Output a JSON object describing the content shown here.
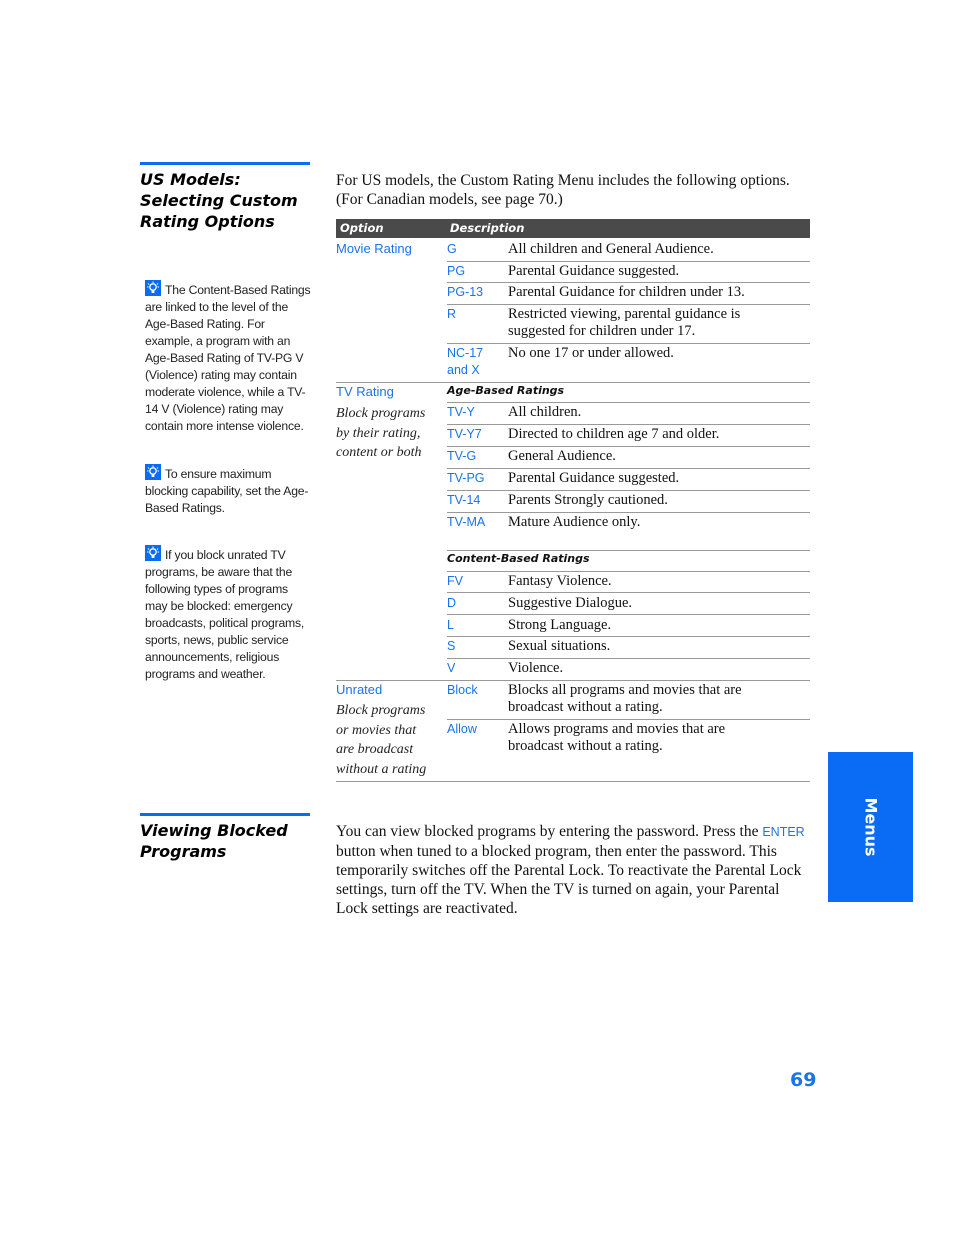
{
  "section1": {
    "heading_lines": [
      "US Models:",
      "Selecting Custom",
      "Rating Options"
    ],
    "intro": "For US models, the Custom Rating Menu includes the following options. (For Canadian models, see page 70.)"
  },
  "notes": [
    {
      "icon": "lightbulb-tip-icon",
      "text": "The Content-Based Ratings are linked to the level of the Age-Based Rating. For example, a program with an Age-Based Rating of TV-PG V (Violence) rating may contain moderate violence, while a TV-14 V (Violence) rating may contain more intense violence."
    },
    {
      "icon": "lightbulb-tip-icon",
      "text": "To ensure maximum blocking capability, set the Age-Based Ratings."
    },
    {
      "icon": "lightbulb-tip-icon",
      "text": "If you block unrated TV programs, be aware that the following types of programs may be blocked: emergency broadcasts, political programs, sports, news, public service announcements, religious programs and weather."
    }
  ],
  "table": {
    "headers": {
      "option": "Option",
      "description": "Description"
    },
    "movie": {
      "option": "Movie Rating",
      "rows": [
        {
          "code": "G",
          "desc": "All children and General Audience."
        },
        {
          "code": "PG",
          "desc": "Parental Guidance suggested."
        },
        {
          "code": "PG-13",
          "desc": "Parental Guidance for children under 13."
        },
        {
          "code": "R",
          "desc": "Restricted viewing, parental guidance is suggested for children under 17."
        },
        {
          "code": "NC-17 and X",
          "desc": "No one 17 or under allowed."
        }
      ]
    },
    "tv": {
      "option": "TV Rating",
      "option_note": "Block programs by their rating, content or both",
      "age_heading": "Age-Based Ratings",
      "age_rows": [
        {
          "code": "TV-Y",
          "desc": "All children."
        },
        {
          "code": "TV-Y7",
          "desc": "Directed to children age 7 and older."
        },
        {
          "code": "TV-G",
          "desc": "General Audience."
        },
        {
          "code": "TV-PG",
          "desc": "Parental Guidance suggested."
        },
        {
          "code": "TV-14",
          "desc": "Parents Strongly cautioned."
        },
        {
          "code": "TV-MA",
          "desc": "Mature Audience only."
        }
      ],
      "content_heading": "Content-Based Ratings",
      "content_rows": [
        {
          "code": "FV",
          "desc": "Fantasy Violence."
        },
        {
          "code": "D",
          "desc": "Suggestive Dialogue."
        },
        {
          "code": "L",
          "desc": "Strong Language."
        },
        {
          "code": "S",
          "desc": "Sexual situations."
        },
        {
          "code": "V",
          "desc": "Violence."
        }
      ]
    },
    "unrated": {
      "option": "Unrated",
      "option_note": "Block programs or movies that are broadcast without a rating",
      "rows": [
        {
          "code": "Block",
          "desc": "Blocks all programs and movies that are broadcast without a rating."
        },
        {
          "code": "Allow",
          "desc": "Allows programs and movies that are broadcast without a rating."
        }
      ]
    }
  },
  "section2": {
    "heading_lines": [
      "Viewing Blocked",
      "Programs"
    ],
    "text_before": "You can view blocked programs by entering the password. Press the ",
    "button_name": "ENTER",
    "text_after": " button when tuned to a blocked program, then enter the password. This temporarily switches off the Parental Lock. To reactivate the Parental Lock settings, turn off the TV. When the TV is turned on again, your Parental Lock settings are reactivated."
  },
  "side_tab": "Menus",
  "page_number": "69",
  "colors": {
    "accent_blue": "#0a6cf5",
    "link_blue": "#1a73e8",
    "table_header": "#4a4a4a"
  }
}
